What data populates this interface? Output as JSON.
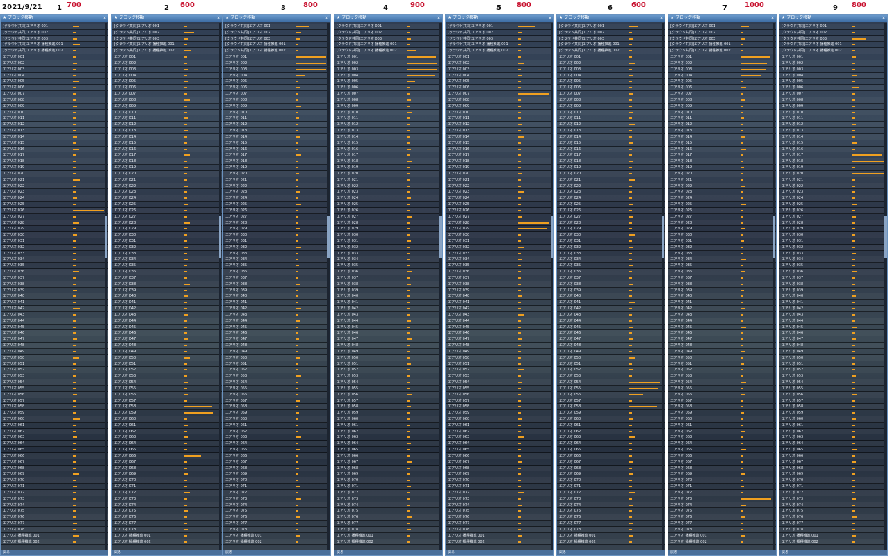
{
  "header": {
    "date": "2021/9/21",
    "columns": [
      {
        "num": "1",
        "value": "700"
      },
      {
        "num": "2",
        "value": "600"
      },
      {
        "num": "3",
        "value": "800"
      },
      {
        "num": "4",
        "value": "900"
      },
      {
        "num": "5",
        "value": "800"
      },
      {
        "num": "6",
        "value": "600"
      },
      {
        "num": "7",
        "value": "1000"
      },
      {
        "num": "9",
        "value": "800"
      }
    ]
  },
  "panel": {
    "title": "★ ブロック移動",
    "close_glyph": "×",
    "footer": "戻る",
    "rows": [
      "[クラウド共同]エアリオ 001",
      "[クラウド共同]エアリオ 002",
      "[クラウド共同]エアリオ 003",
      "[クラウド共同]エアリオ 播種推進 001",
      "[クラウド共同]エアリオ 播種推進 002",
      "エアリオ 001",
      "エアリオ 002",
      "エアリオ 003",
      "エアリオ 004",
      "エアリオ 005",
      "エアリオ 006",
      "エアリオ 007",
      "エアリオ 008",
      "エアリオ 009",
      "エアリオ 010",
      "エアリオ 011",
      "エアリオ 012",
      "エアリオ 013",
      "エアリオ 014",
      "エアリオ 015",
      "エアリオ 016",
      "エアリオ 017",
      "エアリオ 018",
      "エアリオ 019",
      "エアリオ 020",
      "エアリオ 021",
      "エアリオ 022",
      "エアリオ 023",
      "エアリオ 024",
      "エアリオ 025",
      "エアリオ 026",
      "エアリオ 027",
      "エアリオ 028",
      "エアリオ 029",
      "エアリオ 030",
      "エアリオ 031",
      "エアリオ 032",
      "エアリオ 033",
      "エアリオ 034",
      "エアリオ 035",
      "エアリオ 036",
      "エアリオ 037",
      "エアリオ 038",
      "エアリオ 039",
      "エアリオ 040",
      "エアリオ 041",
      "エアリオ 042",
      "エアリオ 043",
      "エアリオ 044",
      "エアリオ 045",
      "エアリオ 046",
      "エアリオ 047",
      "エアリオ 048",
      "エアリオ 049",
      "エアリオ 050",
      "エアリオ 051",
      "エアリオ 052",
      "エアリオ 053",
      "エアリオ 054",
      "エアリオ 055",
      "エアリオ 056",
      "エアリオ 057",
      "エアリオ 058",
      "エアリオ 059",
      "エアリオ 060",
      "エアリオ 061",
      "エアリオ 062",
      "エアリオ 063",
      "エアリオ 064",
      "エアリオ 065",
      "エアリオ 066",
      "エアリオ 067",
      "エアリオ 068",
      "エアリオ 069",
      "エアリオ 070",
      "エアリオ 071",
      "エアリオ 072",
      "エアリオ 073",
      "エアリオ 074",
      "エアリオ 075",
      "エアリオ 076",
      "エアリオ 077",
      "エアリオ 078",
      "エアリオ 播種推進 001",
      "エアリオ 播種推進 002"
    ]
  },
  "colors": {
    "bar": "#f0a020",
    "title_bar": "#4f80b8",
    "header_value": "#c8102e"
  }
}
